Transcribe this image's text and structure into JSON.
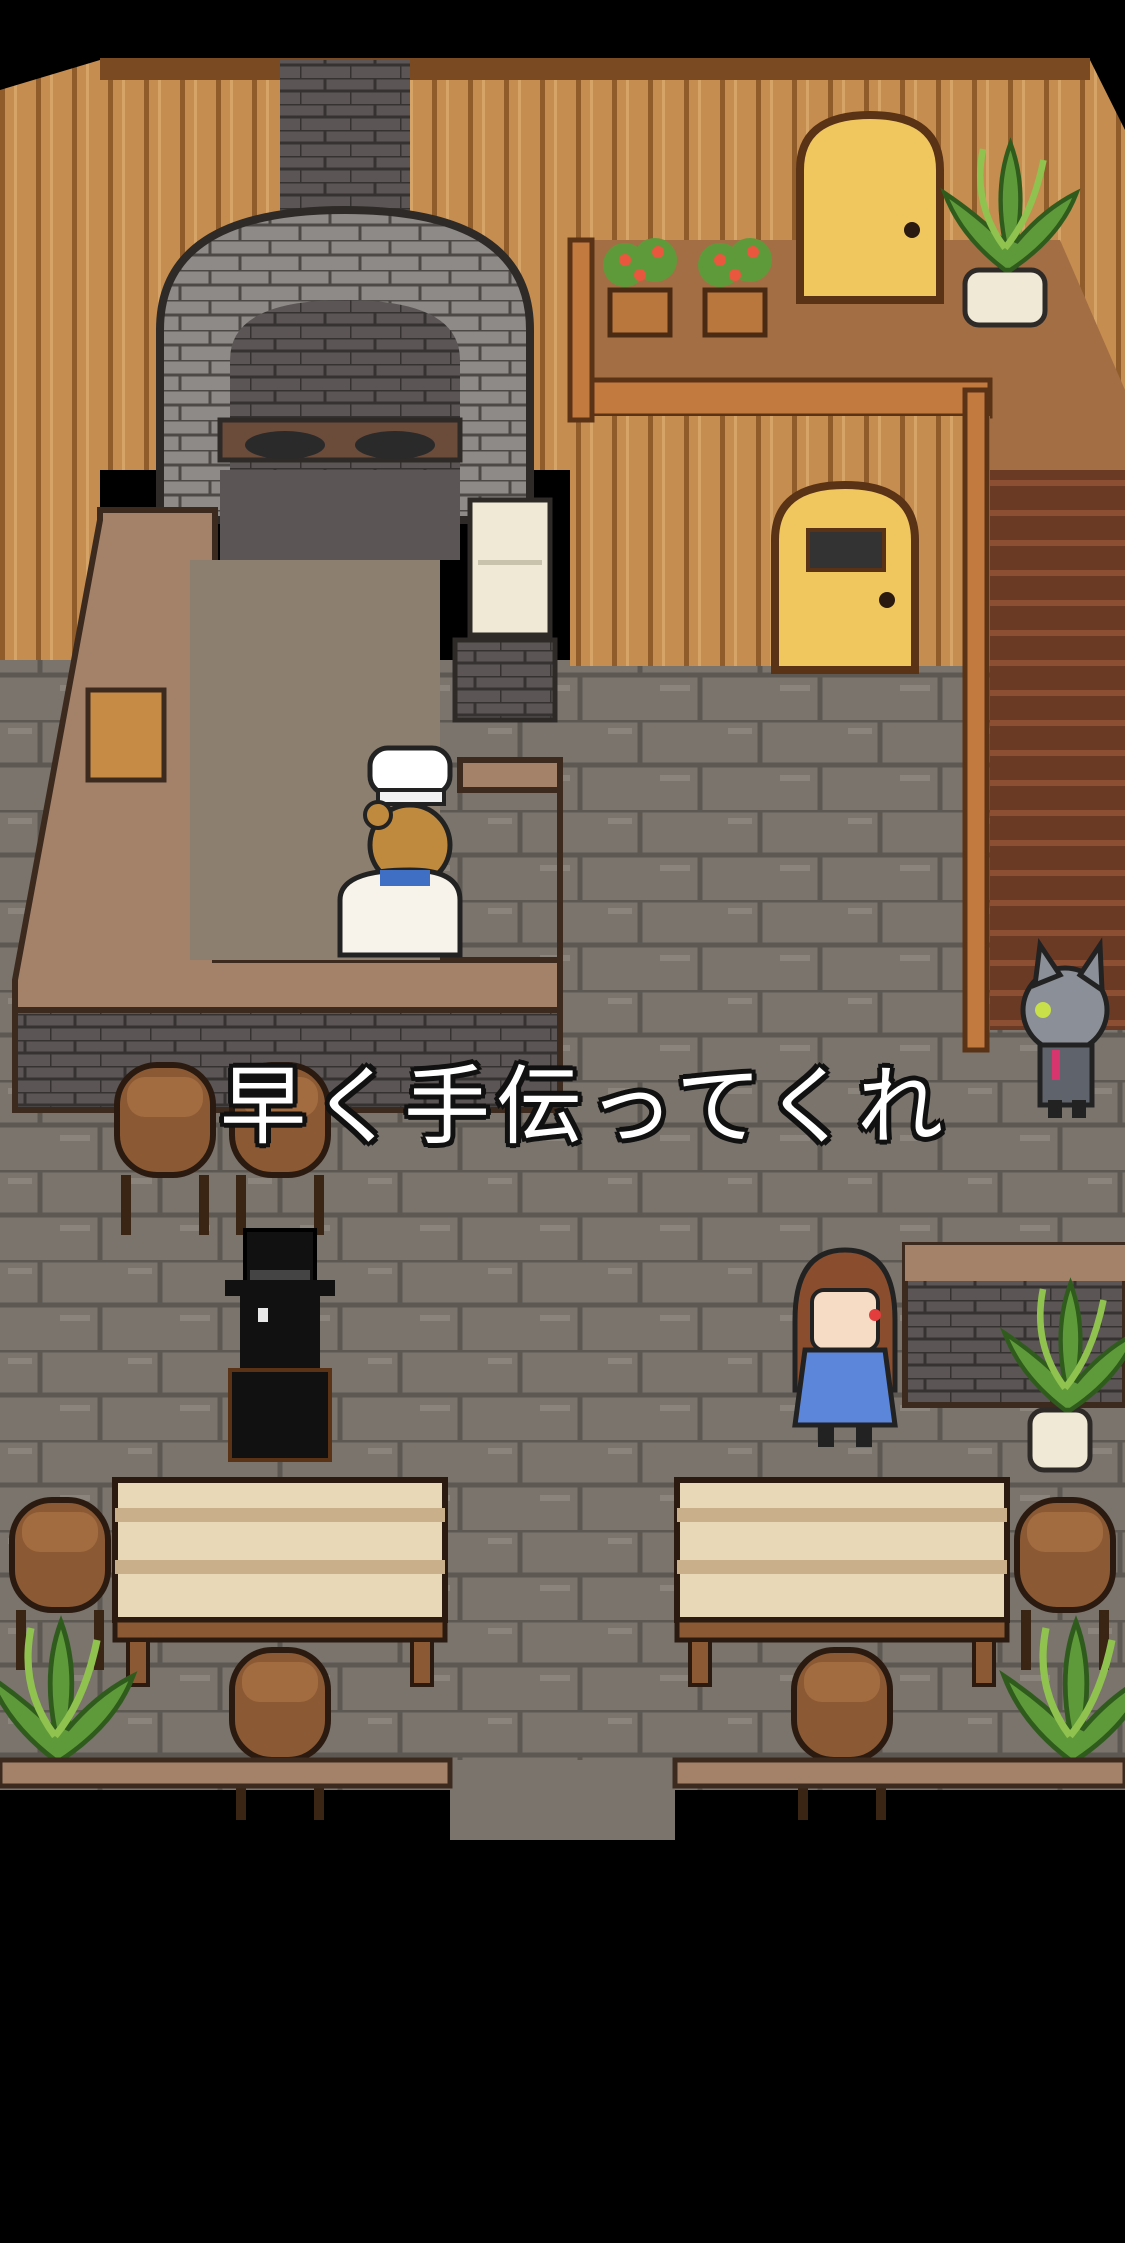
{
  "dialogue": {
    "text": "早く手伝ってくれ"
  },
  "scene": {
    "location": "tavern-kitchen",
    "characters": [
      "bear-chef",
      "shadow-figure-top-hat",
      "girl-blue-apron",
      "gray-cat"
    ]
  },
  "colors": {
    "background": "#000000",
    "wood_wall": "#c58d4f",
    "stone_floor": "#7d7770",
    "counter": "#a4826a",
    "table_top": "#e9d8b8",
    "text": "#ffffff"
  }
}
